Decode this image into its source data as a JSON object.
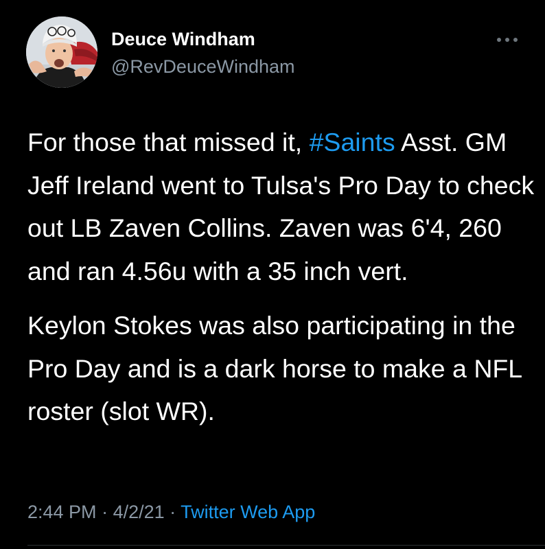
{
  "author": {
    "name": "Deuce Windham",
    "handle": "@RevDeuceWindham",
    "avatar_icon": "profile-photo"
  },
  "menu": {
    "icon": "more-horizontal-icon"
  },
  "tweet": {
    "p1_before": "For those that missed it, ",
    "hashtag": "#Saints",
    "p1_after": " Asst. GM Jeff Ireland went to Tulsa's Pro Day to check out LB Zaven Collins. Zaven was 6'4, 260 and ran 4.56u with a 35 inch vert.",
    "p2": "Keylon Stokes was also participating in the Pro Day and is a dark horse to make a NFL roster (slot WR)."
  },
  "meta": {
    "time": "2:44 PM",
    "sep1": " · ",
    "date": "4/2/21",
    "sep2": " · ",
    "source": "Twitter Web App"
  },
  "colors": {
    "background": "#000000",
    "text": "#ffffff",
    "secondary": "#8b98a5",
    "link": "#1d9bf0"
  }
}
